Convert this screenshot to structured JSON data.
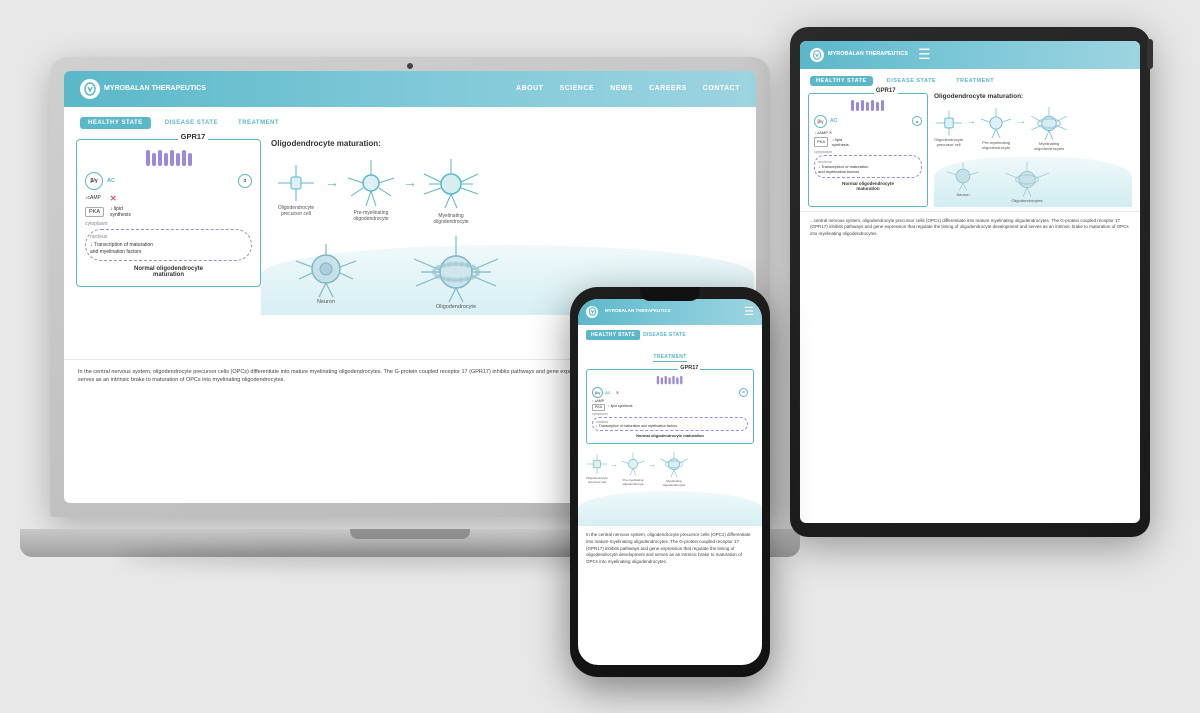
{
  "brand": {
    "name": "MYROBALAN\nTHERAPEUTICS",
    "logo_char": "M"
  },
  "laptop": {
    "nav": {
      "links": [
        "ABOUT",
        "SCIENCE",
        "NEWS",
        "CAREERS",
        "CONTACT"
      ]
    },
    "tabs": {
      "active": "HEALTHY STATE",
      "inactive": [
        "DISEASE STATE",
        "TREATMENT"
      ]
    },
    "section_title": "Oligodendrocyte maturation:",
    "cells": [
      {
        "label": "Oligodendrocyte\nprecursor cell"
      },
      {
        "label": "Pre-myelinating\noligodendrocyte"
      },
      {
        "label": "Myelinating\noligodendrocyte"
      }
    ],
    "diagram": {
      "receptor": "GPR17",
      "labels": [
        "AC",
        "β/γ",
        "α",
        "↓cAMP",
        "PKA",
        "↓ lipid\nsynthesis",
        "cytoplasm",
        "nucleus"
      ],
      "nucleus_text": "↓ Transcription of maturation\nand myelination factors",
      "caption": "Normal oligodendrocyte\nmaturation"
    },
    "body_text": "In the central nervous system, oligodendrocyte precursor cells (OPCs) differentiate into mature myelinating oligodendrocytes. The G-protein coupled receptor 17 (GPR17) inhibits pathways and gene expression that regulate the timing of oligodendrocyte development and serves as an intrinsic brake to maturation of OPCs into myelinating oligodendrocytes.",
    "bottom_labels": [
      "Neuron",
      "Oligodendrocyte"
    ]
  },
  "tablet": {
    "tabs": {
      "active": "HealTHY State",
      "inactive": [
        "DISEASE STATE",
        "TREATMENT"
      ]
    },
    "body_text": "...central nervous system, oligodendrocyte precursor cells (OPCs) differentiate into mature myelinating oligodendrocytes. The G-protein coupled receptor 17 (GPR17) inhibits pathways and gene expression that regulate the timing of oligodendrocyte development and serves as an intrinsic brake to maturation of OPCs into myelinating oligodendrocytes."
  },
  "phone": {
    "tabs": {
      "active": "HEALTHY STATE",
      "inactive": [
        "DISEASE STATE"
      ]
    },
    "treatment_label": "TREATMENT",
    "body_text": "In the central nervous system, oligodendrocyte precursor cells (OPCs) differentiate into mature myelinating oligodendrocytes. The G-protein coupled receptor 17 (GPR17) inhibits pathways and gene expression that regulate the timing of oligodendrocyte development and serves as an intrinsic brake to maturation of OPCs into myelinating oligodendrocytes."
  }
}
